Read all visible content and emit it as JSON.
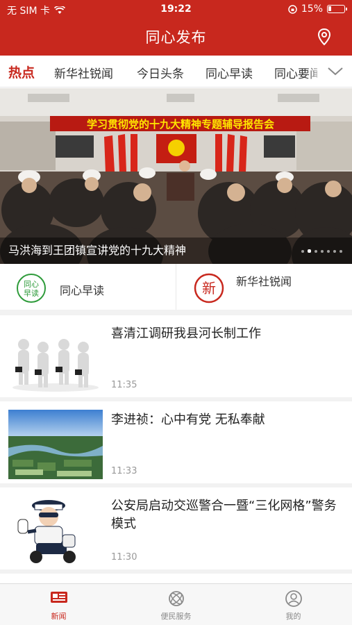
{
  "status_bar": {
    "carrier": "无 SIM 卡",
    "time": "19:22",
    "battery": "15%"
  },
  "header": {
    "title": "同心发布",
    "location_icon": "location-pin-icon"
  },
  "tabs": [
    {
      "label": "热点",
      "active": true
    },
    {
      "label": "新华社锐闻",
      "active": false
    },
    {
      "label": "今日头条",
      "active": false
    },
    {
      "label": "同心早读",
      "active": false
    },
    {
      "label": "同心要闻",
      "active": false
    }
  ],
  "banner": {
    "caption": "马洪海到王团镇宣讲党的十九大精神",
    "slogan": "学习贯彻党的十九大精神专题辅导报告会",
    "slides": 7,
    "active_slide": 2
  },
  "quick_links": [
    {
      "label": "同心早读",
      "logo_text": "同心早读"
    },
    {
      "label": "新华社锐闻",
      "logo_text": "新"
    }
  ],
  "news": [
    {
      "title": "喜清江调研我县河长制工作",
      "time": "11:35"
    },
    {
      "title": "李进祯：心中有党 无私奉献",
      "time": "11:33"
    },
    {
      "title": "公安局启动交巡警合一暨“三化网格”警务模式",
      "time": "11:30"
    }
  ],
  "tabbar": [
    {
      "label": "新闻",
      "icon": "newspaper-icon",
      "active": true
    },
    {
      "label": "便民服务",
      "icon": "service-icon",
      "active": false
    },
    {
      "label": "我的",
      "icon": "profile-icon",
      "active": false
    }
  ],
  "colors": {
    "brand": "#c8281e",
    "time": "#999999"
  }
}
